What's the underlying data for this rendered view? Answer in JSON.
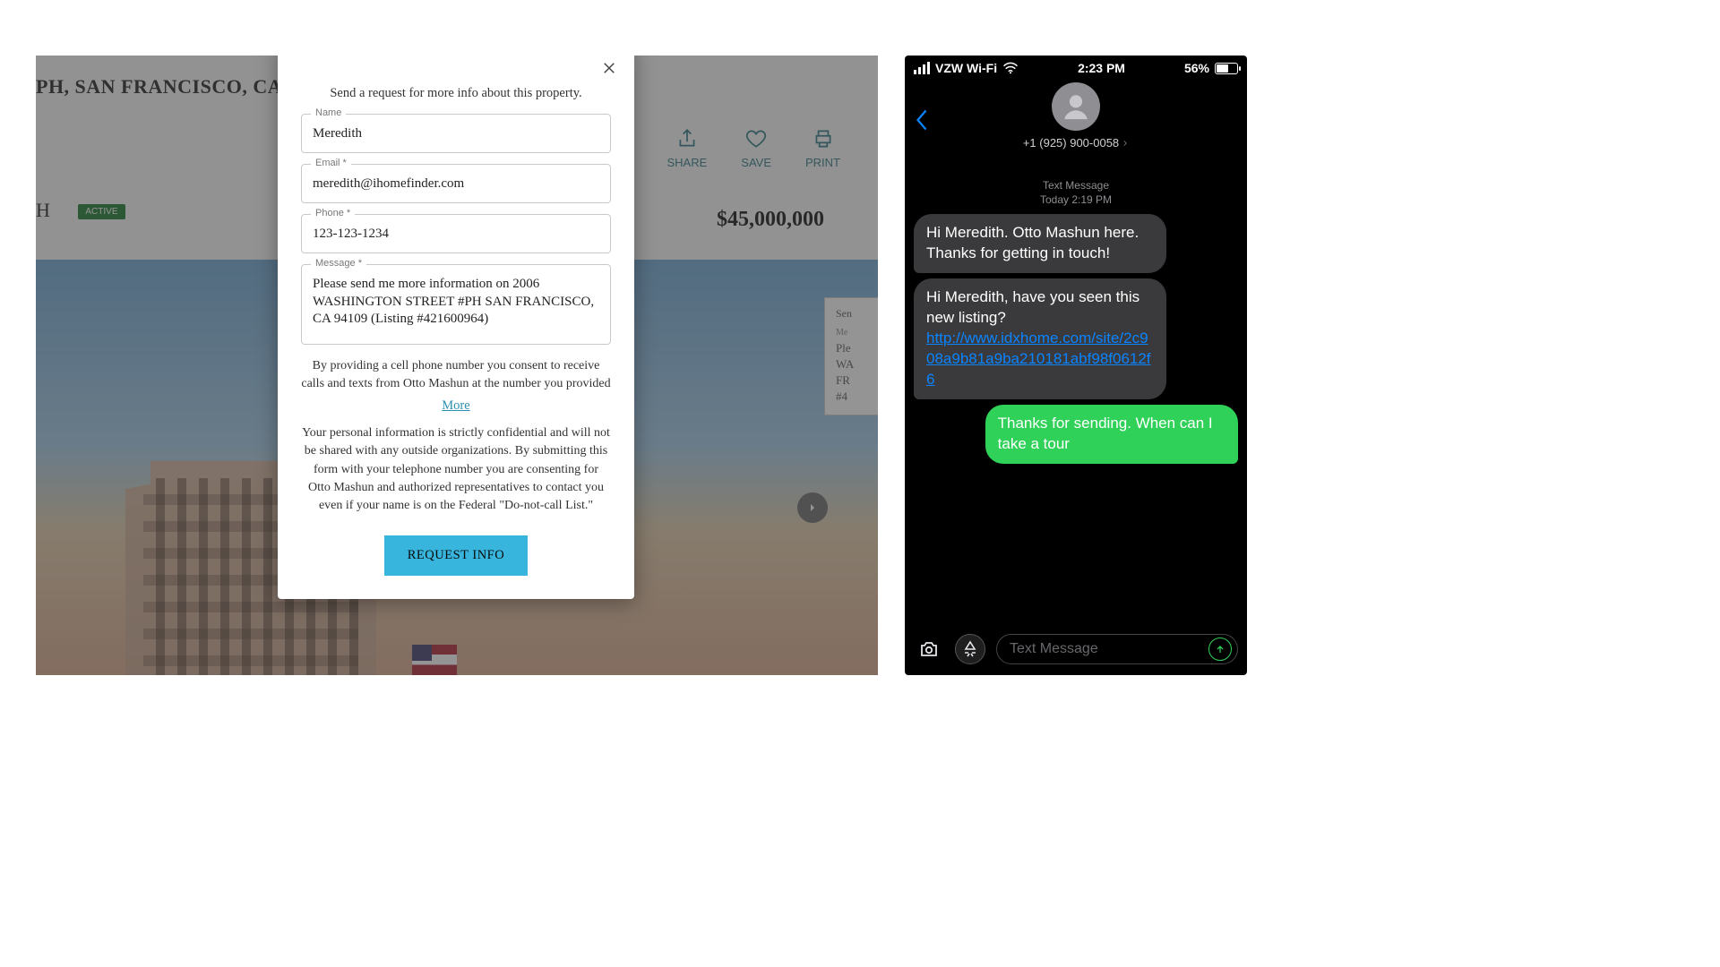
{
  "listing": {
    "title_fragment": "PH, SAN FRANCISCO, CA",
    "subtitle_fragment": "H",
    "status_badge": "ACTIVE",
    "price": "$45,000,000",
    "actions": {
      "share": "SHARE",
      "save": "SAVE",
      "print": "PRINT"
    },
    "side_hint": {
      "title": "Sen",
      "label": "Me",
      "line1": "Ple",
      "line2": "WA",
      "line3": "FR",
      "line4": "#4"
    }
  },
  "modal": {
    "intro": "Send a request for more info about this property.",
    "fields": {
      "name": {
        "label": "Name",
        "value": "Meredith"
      },
      "email": {
        "label": "Email *",
        "value": "meredith@ihomefinder.com"
      },
      "phone": {
        "label": "Phone *",
        "value": "123-123-1234"
      },
      "message": {
        "label": "Message *",
        "value": "Please send me more information on 2006 WASHINGTON STREET #PH SAN FRANCISCO, CA 94109 (Listing #421600964)"
      }
    },
    "consent": "By providing a cell phone number you consent to receive calls and texts from Otto Mashun at the number you provided",
    "more": "More",
    "privacy": "Your personal information is strictly confidential and will not be shared with any outside organizations. By submitting this form with your telephone number you are consenting for Otto Mashun and authorized representatives to contact you even if your name is on the Federal \"Do-not-call List.\"",
    "submit": "REQUEST INFO"
  },
  "phone": {
    "statusbar": {
      "carrier": "VZW Wi-Fi",
      "time": "2:23 PM",
      "battery_pct": "56%"
    },
    "contact_number": "+1 (925) 900-0058",
    "meta_line1": "Text Message",
    "meta_line2": "Today 2:19 PM",
    "messages": {
      "m1": "Hi Meredith. Otto Mashun here. Thanks for getting in touch!",
      "m2_text": "Hi Meredith, have you seen this new listing? ",
      "m2_link": "http://www.idxhome.com/site/2c908a9b81a9ba210181abf98f0612f6",
      "m3": "Thanks for sending. When can I take a tour"
    },
    "composer_placeholder": "Text Message"
  }
}
